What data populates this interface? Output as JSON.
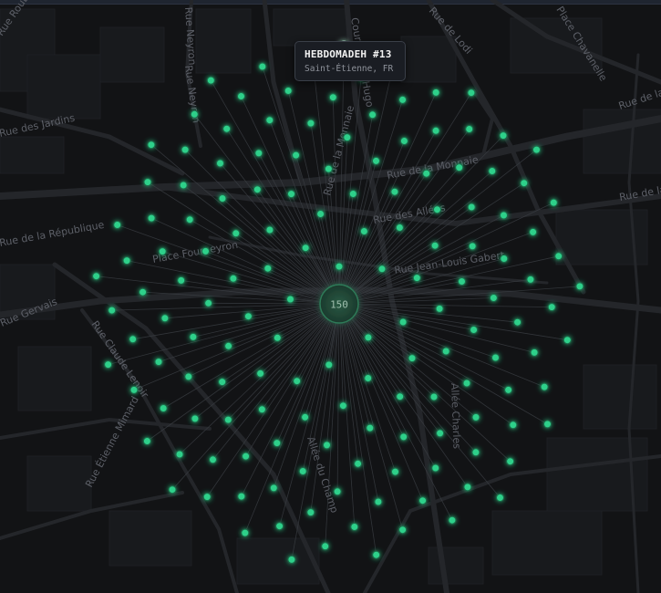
{
  "map": {
    "style": "dark",
    "accent_color": "#3ddc97",
    "node_color": "#2fd08a",
    "hub_color": "#1f4a37",
    "street_labels": [
      "Rue Roubaix",
      "Rue Neyron",
      "Rue Neyron",
      "Cours Victor Hugo",
      "Rue de Lodi",
      "Place Chavanelle",
      "Rue de la Mulatière",
      "Rue de la Mulatière",
      "Rue des Jardins",
      "Rue des Allées",
      "Rue de la Monnaie",
      "Rue de la Monnaie",
      "Rue de la République",
      "Place Fourneyron",
      "Rue Jean-Louis Gabert",
      "Rue Gervais",
      "Rue Claude Lenoir",
      "Rue Étienne Mimard",
      "Allée du Champ",
      "Allée Charles"
    ]
  },
  "cluster": {
    "count_label": "150",
    "node_count": 150,
    "icon": "cluster-hub-icon"
  },
  "tooltip": {
    "title": "HEBDOMADEH #13",
    "subtitle": "Saint-Étienne, FR"
  }
}
